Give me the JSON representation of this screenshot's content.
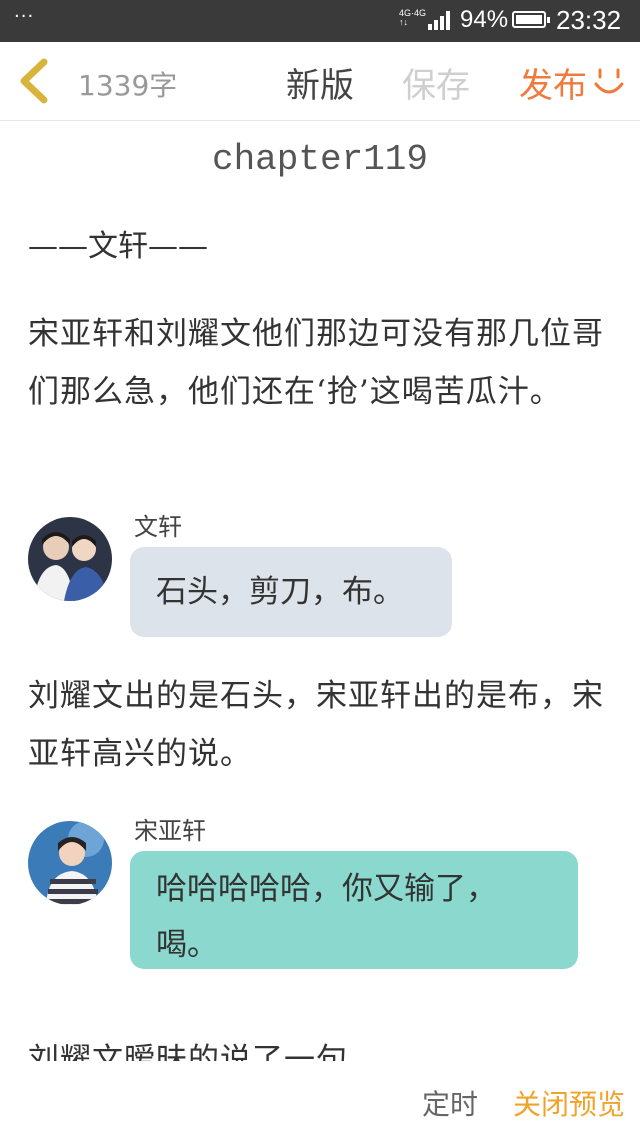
{
  "status_bar": {
    "menu_dots": "···",
    "network_label_1": "4G",
    "network_label_2": "4G",
    "battery_percent": "94%",
    "time": "23:32",
    "battery_level": 0.94
  },
  "top_bar": {
    "word_count": "1339字",
    "new_version_label": "新版",
    "save_label": "保存",
    "publish_label": "发布",
    "accent_color": "#f07a3e"
  },
  "content": {
    "chapter_title": "chapter119",
    "section_heading": "——文轩——",
    "paragraph_1": "宋亚轩和刘耀文他们那边可没有那几位哥们那么急，他们还在‘抢’这喝苦瓜汁。",
    "message_1": {
      "speaker": "文轩",
      "text": "石头，剪刀，布。",
      "bubble_color": "#dde3ea"
    },
    "paragraph_2": "刘耀文出的是石头，宋亚轩出的是布，宋亚轩高兴的说。",
    "message_2": {
      "speaker": "宋亚轩",
      "text": "哈哈哈哈哈，你又输了，喝。",
      "bubble_color": "#8ad8ce"
    },
    "paragraph_3": "刘耀文暧昧的说了一句。"
  },
  "bottom_bar": {
    "timer_label": "定时",
    "close_preview_label": "关闭预览",
    "close_preview_color": "#f0a32a"
  }
}
